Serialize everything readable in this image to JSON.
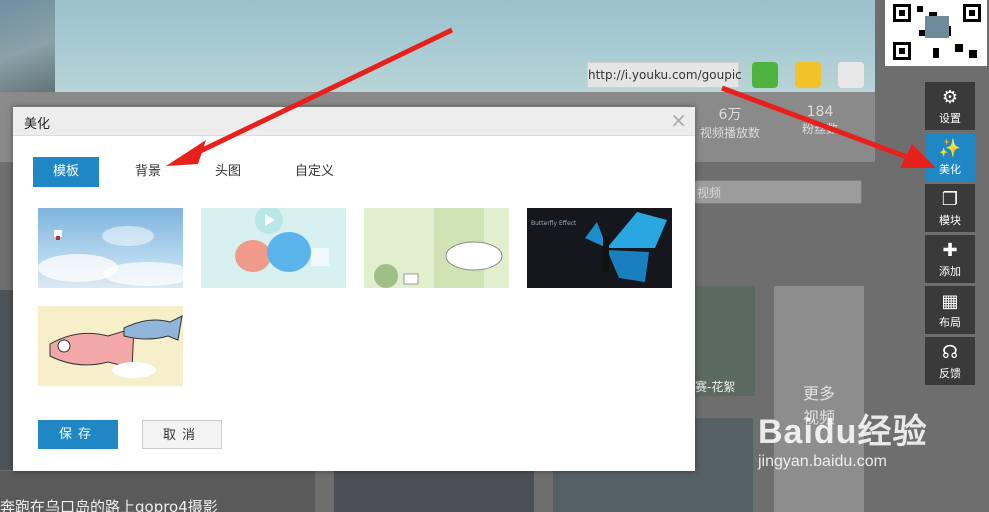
{
  "background_page": {
    "url_text": "http://i.youku.com/goupic",
    "stats": [
      {
        "number": "6万",
        "label": "视频播放数"
      },
      {
        "number": "184",
        "label": "粉丝数"
      }
    ],
    "search_placeholder": "视频",
    "captions": [
      "赛-花絮",
      "更多视频",
      "奔跑在乌口岛的路上gopro4摄影"
    ]
  },
  "toolbar": {
    "items": [
      {
        "label": "设置",
        "icon": "gear-icon",
        "glyph": "⚙"
      },
      {
        "label": "美化",
        "icon": "magic-wand-icon",
        "glyph": "✨"
      },
      {
        "label": "模块",
        "icon": "window-icon",
        "glyph": "❐"
      },
      {
        "label": "添加",
        "icon": "plus-icon",
        "glyph": "✚"
      },
      {
        "label": "布局",
        "icon": "layout-icon",
        "glyph": "▦"
      },
      {
        "label": "反馈",
        "icon": "headset-icon",
        "glyph": "☊"
      }
    ],
    "active_index": 1
  },
  "modal": {
    "title": "美化",
    "close_glyph": "×",
    "tabs": [
      "模板",
      "背景",
      "头图",
      "自定义"
    ],
    "active_tab": 0,
    "themes": [
      {
        "name": "sky-clouds",
        "caption": ""
      },
      {
        "name": "cartoon-pals",
        "caption": ""
      },
      {
        "name": "sleeping-cat",
        "caption": ""
      },
      {
        "name": "butterfly",
        "caption": "Butterfly Effect"
      },
      {
        "name": "carp-streamers",
        "caption": ""
      }
    ],
    "save_label": "保存",
    "cancel_label": "取消"
  },
  "watermark": {
    "brand": "Baidu经验",
    "url": "jingyan.baidu.com"
  },
  "colors": {
    "accent": "#1e87c4",
    "arrow": "#e8201c",
    "overlay": "#6e6e6e"
  }
}
